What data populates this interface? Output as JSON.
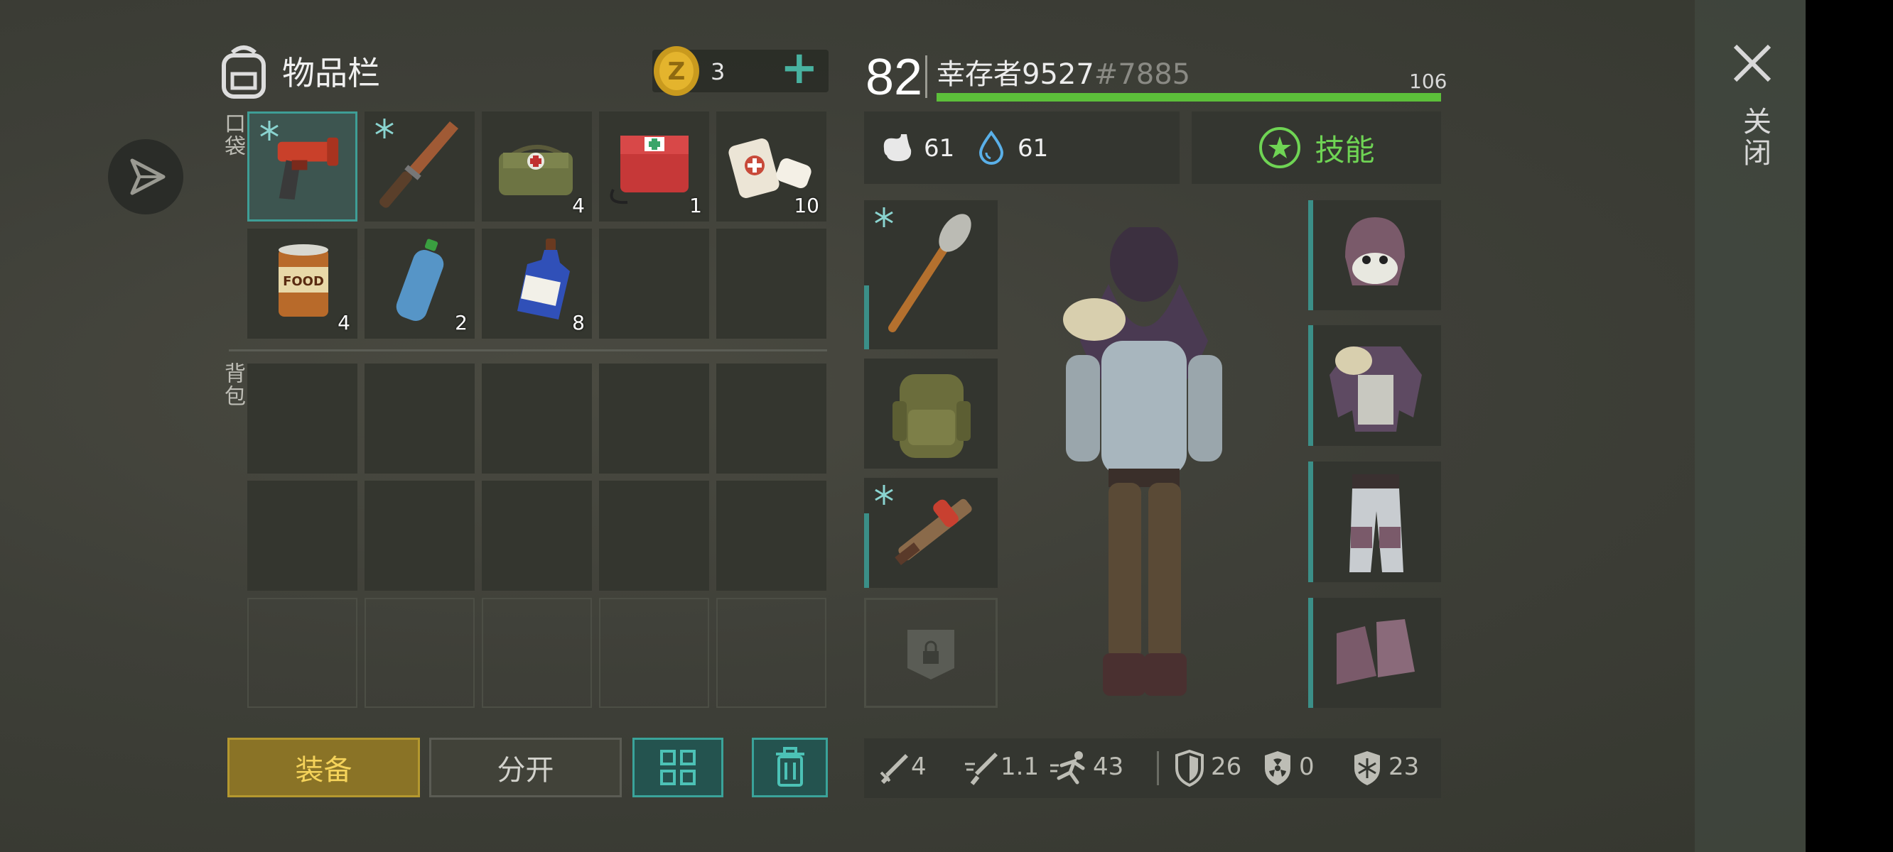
{
  "inventory": {
    "title": "物品栏",
    "coins": "3",
    "plus": "+",
    "pocket_label": "口袋",
    "backpack_label": "背包",
    "pocket_counts": [
      "",
      "",
      "4",
      "1",
      "10",
      "4",
      "2",
      "8"
    ],
    "buttons": {
      "equip": "装备",
      "split": "分开"
    }
  },
  "character": {
    "level": "82",
    "name": "幸存者9527",
    "id": "#7885",
    "hp_max": "106",
    "hp_fraction": 1.0,
    "food": "61",
    "water": "61",
    "skills_label": "技能"
  },
  "stats": {
    "melee": "4",
    "attack_speed": "1.1",
    "speed": "43",
    "armor": "26",
    "radiation": "0",
    "cold": "23"
  },
  "close": {
    "label": "关闭"
  },
  "colors": {
    "accent": "#3e9e96",
    "hp": "#5cbf3a",
    "equip": "#b4982f",
    "skills": "#6fd454"
  }
}
